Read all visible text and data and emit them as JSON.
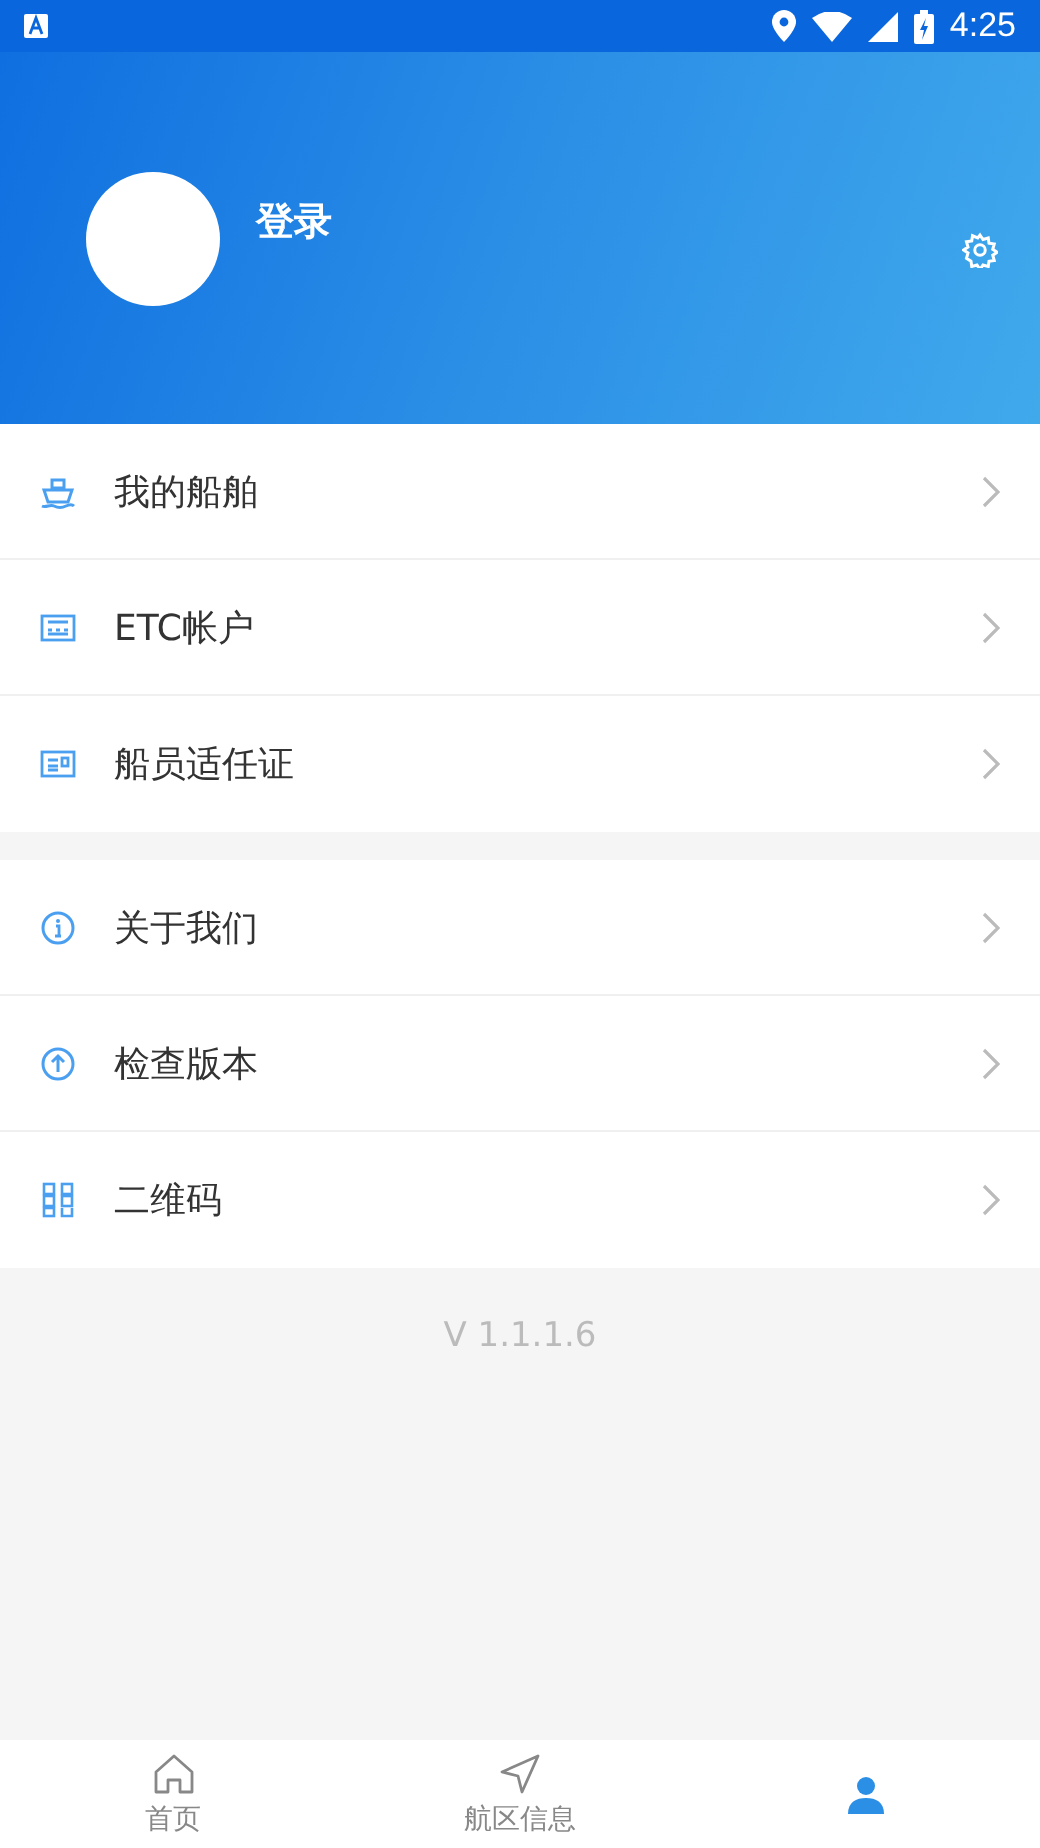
{
  "status_bar": {
    "time": "4:25"
  },
  "header": {
    "login": "登录"
  },
  "menu_groups": [
    {
      "items": [
        {
          "kind": "ship",
          "label": "我的船舶"
        },
        {
          "kind": "etc",
          "label": "ETC帐户"
        },
        {
          "kind": "card",
          "label": "船员适任证"
        }
      ]
    },
    {
      "items": [
        {
          "kind": "info",
          "label": "关于我们"
        },
        {
          "kind": "upgrade",
          "label": "检查版本"
        },
        {
          "kind": "qr",
          "label": "二维码"
        }
      ]
    }
  ],
  "version": "V 1.1.1.6",
  "bottom_nav": [
    {
      "kind": "home",
      "label": "首页",
      "selected": false
    },
    {
      "kind": "navigate",
      "label": "航区信息",
      "selected": false
    },
    {
      "kind": "person",
      "selected": true
    }
  ]
}
